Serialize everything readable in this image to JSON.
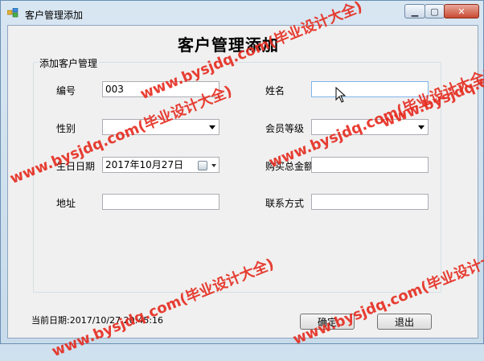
{
  "window": {
    "title": "客户管理添加",
    "controls": {
      "minimize": "▁",
      "maximize": "▢",
      "close": "✕"
    }
  },
  "form": {
    "heading": "客户管理添加",
    "group_title": "添加客户管理",
    "fields": {
      "code": {
        "label": "编号",
        "value": "003"
      },
      "name": {
        "label": "姓名",
        "value": ""
      },
      "gender": {
        "label": "性别",
        "value": ""
      },
      "member_level": {
        "label": "会员等级",
        "value": ""
      },
      "birthday": {
        "label": "生日日期",
        "value": "2017年10月27日"
      },
      "total_purchase": {
        "label": "购买总金额",
        "value": ""
      },
      "address": {
        "label": "地址",
        "value": ""
      },
      "contact": {
        "label": "联系方式",
        "value": ""
      }
    }
  },
  "status": {
    "current_date_label": "当前日期:",
    "current_date_value": "2017/10/27 20:45:16"
  },
  "buttons": {
    "confirm": "确定",
    "exit": "退出"
  },
  "watermarks": [
    "www.bysjdq.com(毕业设计大全)",
    "www.bysjdq.com(毕业设计大全)",
    "www.bysjdq.com(毕业设计大全)",
    "www.bysjdq.com(毕业设计大全)",
    "www.bysjdq.com(毕业设计大全)",
    "www.bysjdq.com(毕业设计大全)"
  ],
  "colors": {
    "watermark": "#e62a1e",
    "close_button": "#c94a33",
    "focus_border": "#7eb4ea"
  }
}
